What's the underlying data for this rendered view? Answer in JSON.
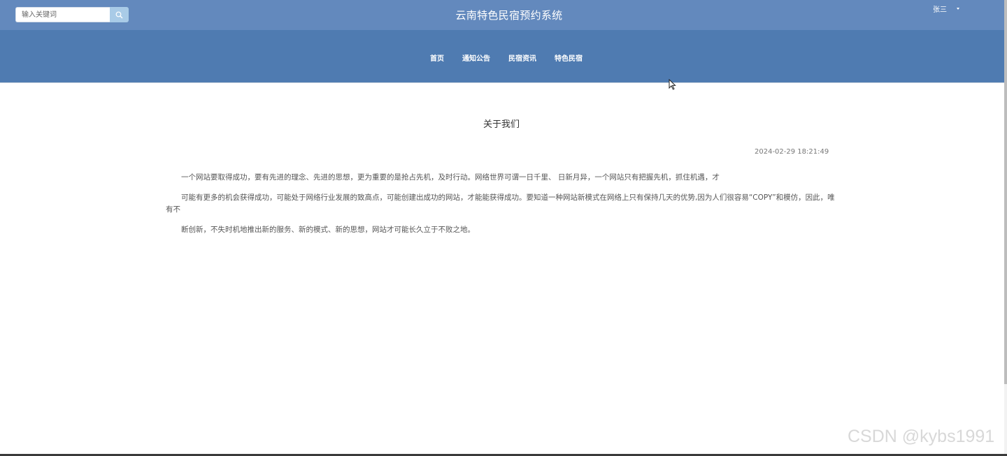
{
  "header": {
    "search_placeholder": "输入关键词",
    "site_title": "云南特色民宿预约系统",
    "user_name": "张三"
  },
  "nav": {
    "items": [
      {
        "label": "首页"
      },
      {
        "label": "通知公告"
      },
      {
        "label": "民宿资讯"
      },
      {
        "label": "特色民宿"
      }
    ]
  },
  "content": {
    "title": "关于我们",
    "date": "2024-02-29 18:21:49",
    "paragraphs": [
      "一个网站要取得成功，要有先进的理念、先进的思想，更为重要的是抢占先机，及时行动。网络世界可谓一日千里、 日新月异，一个网站只有把握先机，抓住机遇，才",
      "可能有更多的机会获得成功，可能处于网络行业发展的致高点，可能创建出成功的网站，才能能获得成功。要知道一种网站新模式在网络上只有保持几天的优势,因为人们很容易“COPY”和模仿，因此，唯有不",
      "断创新，不失时机地推出新的服务、新的模式、新的思想，网站才可能长久立于不败之地。"
    ]
  },
  "watermark": "CSDN @kybs1991",
  "colors": {
    "topbar": "#6389bd",
    "navbar": "#4f7bb1",
    "search_button": "#a9cbe7"
  }
}
